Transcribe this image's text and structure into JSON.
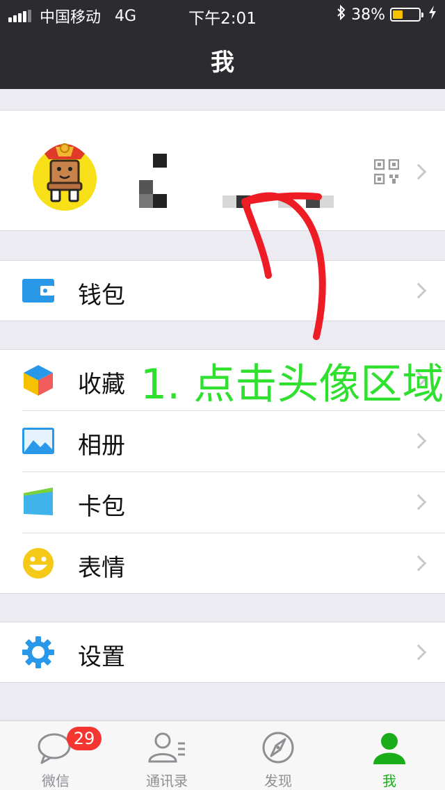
{
  "status_bar": {
    "carrier": "中国移动",
    "network": "4G",
    "time": "下午2:01",
    "battery": "38%",
    "battery_level": 0.38
  },
  "header": {
    "title": "我"
  },
  "menu": {
    "wallet": "钱包",
    "favorites": "收藏",
    "album": "相册",
    "cards": "卡包",
    "stickers": "表情",
    "settings": "设置"
  },
  "annotation": "1. 点击头像区域",
  "tabbar": {
    "tabs": [
      {
        "label": "微信",
        "badge": "29"
      },
      {
        "label": "通讯录"
      },
      {
        "label": "发现"
      },
      {
        "label": "我"
      }
    ]
  },
  "colors": {
    "accent": "#1aad19",
    "annotation_green": "#2fe02f",
    "arrow_red": "#ee1c24",
    "header_bg": "#2c2c30",
    "badge_red": "#f43530"
  }
}
